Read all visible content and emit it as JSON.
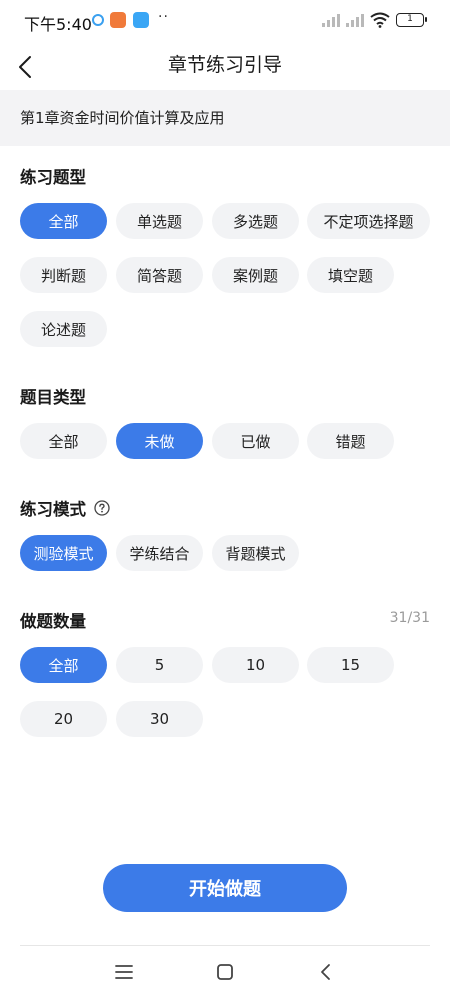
{
  "status_bar": {
    "time": "下午5:40",
    "dots": "··",
    "battery": "1",
    "icons": [
      "app-icon",
      "app-icon",
      "app-icon",
      "signal-icon",
      "signal-icon",
      "wifi-icon",
      "battery-icon"
    ]
  },
  "header": {
    "title": "章节练习引导",
    "back_icon": "chevron-left-icon"
  },
  "chapter": {
    "title": "第1章资金时间价值计算及应用"
  },
  "question_type": {
    "label": "练习题型",
    "options": [
      "全部",
      "单选题",
      "多选题",
      "不定项选择题",
      "判断题",
      "简答题",
      "案例题",
      "填空题",
      "论述题"
    ],
    "selected": "全部"
  },
  "question_status": {
    "label": "题目类型",
    "options": [
      "全部",
      "未做",
      "已做",
      "错题"
    ],
    "selected": "未做"
  },
  "practice_mode": {
    "label": "练习模式",
    "help_icon": "question-circle-icon",
    "options": [
      "测验模式",
      "学练结合",
      "背题模式"
    ],
    "selected": "测验模式"
  },
  "question_count": {
    "label": "做题数量",
    "count": "31/31",
    "options": [
      "全部",
      "5",
      "10",
      "15",
      "20",
      "30"
    ],
    "selected": "全部"
  },
  "start_button": {
    "label": "开始做题"
  },
  "nav_bar": {
    "icons": [
      "menu-icon",
      "home-icon",
      "back-icon"
    ]
  },
  "colors": {
    "accent": "#3c7be8",
    "chip_bg": "#f2f3f5",
    "banner_bg": "#f3f3f5",
    "muted_text": "#9a9a9a"
  }
}
